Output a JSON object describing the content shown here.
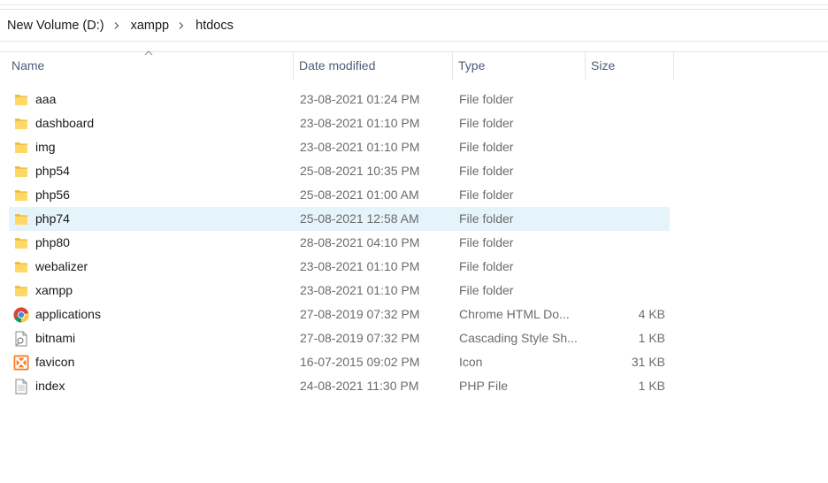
{
  "breadcrumb": [
    "New Volume (D:)",
    "xampp",
    "htdocs"
  ],
  "columns": {
    "name": "Name",
    "date": "Date modified",
    "type": "Type",
    "size": "Size"
  },
  "files": [
    {
      "name": "aaa",
      "date": "23-08-2021 01:24 PM",
      "type": "File folder",
      "size": "",
      "icon": "folder-icon"
    },
    {
      "name": "dashboard",
      "date": "23-08-2021 01:10 PM",
      "type": "File folder",
      "size": "",
      "icon": "folder-icon"
    },
    {
      "name": "img",
      "date": "23-08-2021 01:10 PM",
      "type": "File folder",
      "size": "",
      "icon": "folder-icon"
    },
    {
      "name": "php54",
      "date": "25-08-2021 10:35 PM",
      "type": "File folder",
      "size": "",
      "icon": "folder-icon"
    },
    {
      "name": "php56",
      "date": "25-08-2021 01:00 AM",
      "type": "File folder",
      "size": "",
      "icon": "folder-icon"
    },
    {
      "name": "php74",
      "date": "25-08-2021 12:58 AM",
      "type": "File folder",
      "size": "",
      "icon": "folder-icon",
      "selected": true
    },
    {
      "name": "php80",
      "date": "28-08-2021 04:10 PM",
      "type": "File folder",
      "size": "",
      "icon": "folder-icon"
    },
    {
      "name": "webalizer",
      "date": "23-08-2021 01:10 PM",
      "type": "File folder",
      "size": "",
      "icon": "folder-icon"
    },
    {
      "name": "xampp",
      "date": "23-08-2021 01:10 PM",
      "type": "File folder",
      "size": "",
      "icon": "folder-icon"
    },
    {
      "name": "applications",
      "date": "27-08-2019 07:32 PM",
      "type": "Chrome HTML Do...",
      "size": "4 KB",
      "icon": "chrome-icon"
    },
    {
      "name": "bitnami",
      "date": "27-08-2019 07:32 PM",
      "type": "Cascading Style Sh...",
      "size": "1 KB",
      "icon": "css-file-icon"
    },
    {
      "name": "favicon",
      "date": "16-07-2015 09:02 PM",
      "type": "Icon",
      "size": "31 KB",
      "icon": "xampp-icon"
    },
    {
      "name": "index",
      "date": "24-08-2021 11:30 PM",
      "type": "PHP File",
      "size": "1 KB",
      "icon": "text-file-icon"
    }
  ],
  "colors": {
    "selected_row": "#e5f3fb",
    "header_text": "#4c607a",
    "folder": "#f3c24b"
  }
}
